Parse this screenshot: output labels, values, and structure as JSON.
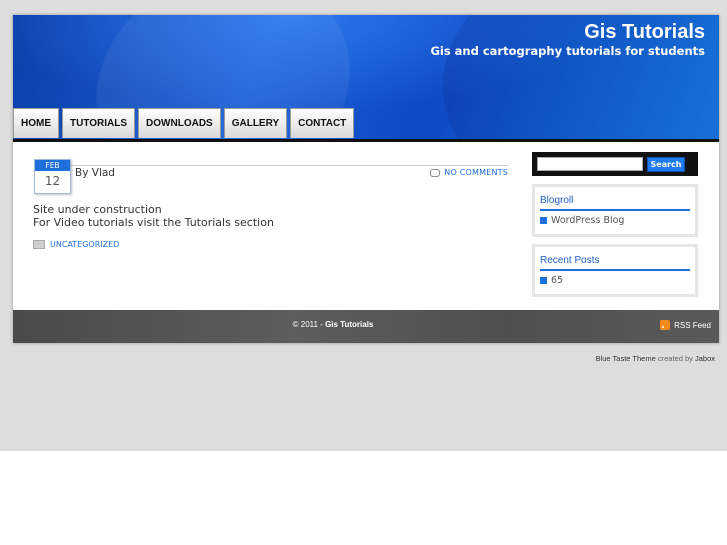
{
  "site": {
    "title": "Gis Tutorials",
    "tagline": "Gis and cartography tutorials for students"
  },
  "nav": {
    "items": [
      "HOME",
      "TUTORIALS",
      "DOWNLOADS",
      "GALLERY",
      "CONTACT"
    ]
  },
  "post": {
    "date_month": "FEB",
    "date_day": "12",
    "author": "By Vlad",
    "comments": "NO COMMENTS",
    "body_line1": "Site under construction",
    "body_line2": "For Video tutorials visit the Tutorials section",
    "category": "UNCATEGORIZED"
  },
  "sidebar": {
    "search_placeholder": "",
    "search_button": "Search",
    "blogroll_title": "Blogroll",
    "blogroll_items": [
      "WordPress Blog"
    ],
    "recent_title": "Recent Posts",
    "recent_items": [
      "65"
    ]
  },
  "footer": {
    "copy_prefix": "© 2011 - ",
    "copy_site": "Gis Tutorials",
    "rss": "RSS Feed"
  },
  "credit": {
    "theme": "Blue Taste Theme",
    "created_by": " created by ",
    "author": "Jabox"
  },
  "colors": {
    "accent": "#1e6fd9",
    "header_dark": "#0a3fa8",
    "footer": "#4f4f4f"
  }
}
